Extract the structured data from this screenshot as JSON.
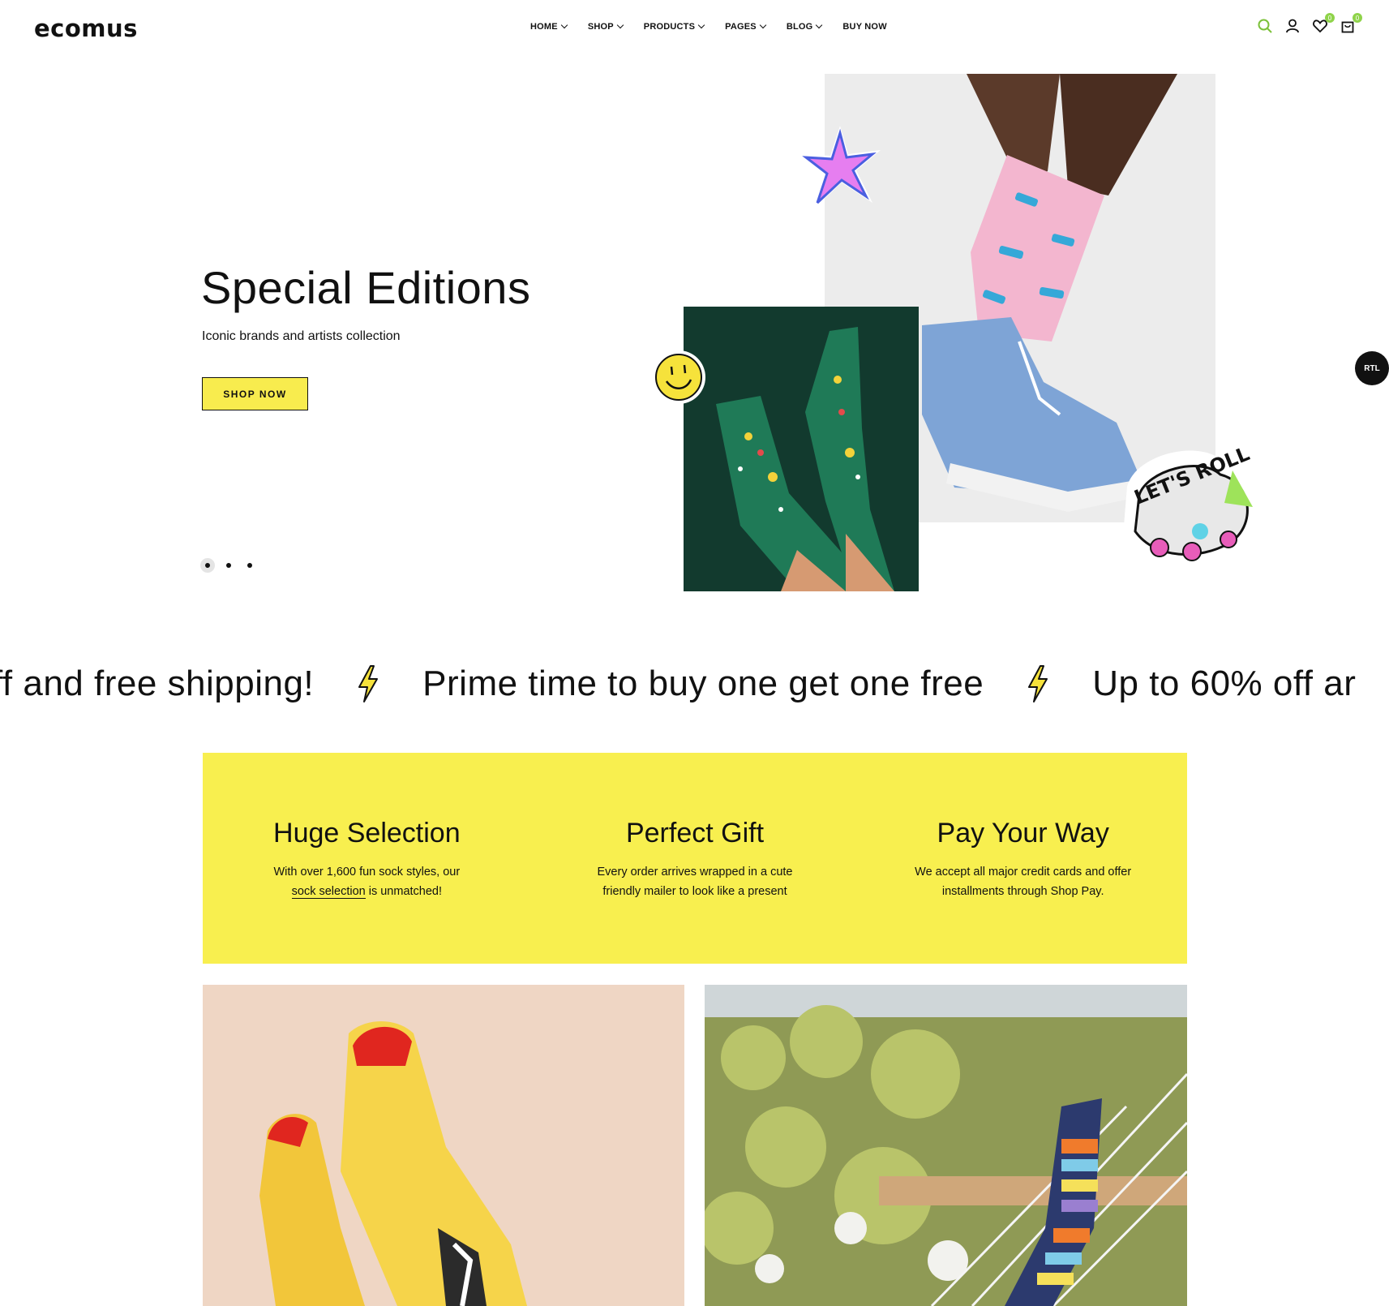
{
  "brand": {
    "logo_text": "ecomus"
  },
  "nav": {
    "items": [
      {
        "label": "HOME",
        "dropdown": true
      },
      {
        "label": "SHOP",
        "dropdown": true
      },
      {
        "label": "PRODUCTS",
        "dropdown": true
      },
      {
        "label": "PAGES",
        "dropdown": true
      },
      {
        "label": "BLOG",
        "dropdown": true
      },
      {
        "label": "BUY NOW",
        "dropdown": false
      }
    ]
  },
  "header_icons": {
    "search": "search-icon",
    "account": "user-icon",
    "wishlist": "heart-icon",
    "wishlist_count": "0",
    "cart": "bag-icon",
    "cart_count": "0"
  },
  "hero": {
    "title": "Special Editions",
    "subtitle": "Iconic brands and artists collection",
    "cta_label": "SHOP NOW",
    "slide_count": 3,
    "active_slide": 1
  },
  "rtl_toggle": "RTL",
  "marquee": {
    "items": [
      "off and free shipping!",
      "Prime time to buy one get one free",
      "Up to 60% off ar"
    ]
  },
  "features": [
    {
      "title": "Huge Selection",
      "text_before": "With over 1,600 fun sock styles, our ",
      "link": "sock selection",
      "text_after": " is unmatched!"
    },
    {
      "title": "Perfect Gift",
      "text_before": "Every order arrives wrapped in a cute friendly mailer to look like a present",
      "link": "",
      "text_after": ""
    },
    {
      "title": "Pay Your Way",
      "text_before": "We accept all major credit cards and offer installments through Shop Pay.",
      "link": "",
      "text_after": ""
    }
  ],
  "colors": {
    "accent_yellow": "#f8ef4f",
    "badge_green": "#8fd34a",
    "text": "#111111"
  },
  "stickers": {
    "roller": "LET'S ROLL"
  }
}
